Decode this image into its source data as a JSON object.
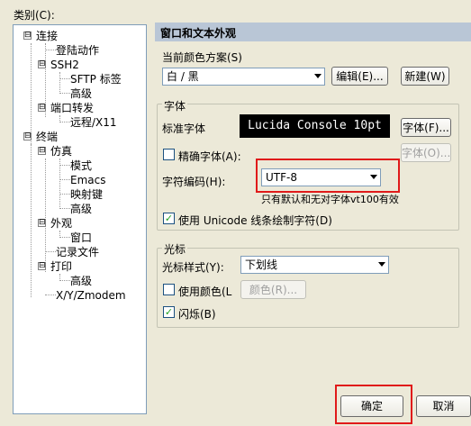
{
  "category_label": "类别(C):",
  "tree": {
    "items": [
      {
        "label": "连接",
        "expander": "⊟"
      },
      {
        "label": "登陆动作"
      },
      {
        "label": "SSH2",
        "expander": "⊟"
      },
      {
        "label": "SFTP 标签"
      },
      {
        "label": "高级"
      },
      {
        "label": "端口转发",
        "expander": "⊟"
      },
      {
        "label": "远程/X11"
      },
      {
        "label": "终端",
        "expander": "⊟"
      },
      {
        "label": "仿真",
        "expander": "⊟"
      },
      {
        "label": "模式"
      },
      {
        "label": "Emacs"
      },
      {
        "label": "映射键"
      },
      {
        "label": "高级"
      },
      {
        "label": "外观",
        "expander": "⊟"
      },
      {
        "label": "窗口"
      },
      {
        "label": "记录文件"
      },
      {
        "label": "打印",
        "expander": "⊟"
      },
      {
        "label": "高级"
      },
      {
        "label": "X/Y/Zmodem"
      }
    ]
  },
  "panel": {
    "title": "窗口和文本外观",
    "scheme": {
      "label": "当前颜色方案(S)",
      "value": "白 / 黑",
      "edit_button": "编辑(E)...",
      "new_button": "新建(W)"
    },
    "font": {
      "group_label": "字体",
      "standard_font_label": "标准字体",
      "standard_font_preview": "Lucida Console 10pt",
      "font_button": "字体(F)...",
      "precise_font_label": "精确字体(A):",
      "precise_font_checked": false,
      "precise_font_button": "字体(O)...",
      "encoding_label": "字符编码(H):",
      "encoding_value": "UTF-8",
      "encoding_note": "只有默认和无对字体vt100有效",
      "unicode_label": "使用 Unicode 线条绘制字符(D)",
      "unicode_checked": true
    },
    "cursor": {
      "group_label": "光标",
      "style_label": "光标样式(Y):",
      "style_value": "下划线",
      "use_color_label": "使用颜色(L",
      "use_color_checked": false,
      "color_button": "颜色(R)...",
      "blink_label": "闪烁(B)",
      "blink_checked": true
    }
  },
  "footer": {
    "ok_button": "确定",
    "cancel_button": "取消"
  },
  "colors": {
    "header_bg": "#b9c6d6",
    "window_bg": "#ece9d8",
    "highlight_red": "#e01a1a",
    "font_preview_bg": "#000000"
  }
}
